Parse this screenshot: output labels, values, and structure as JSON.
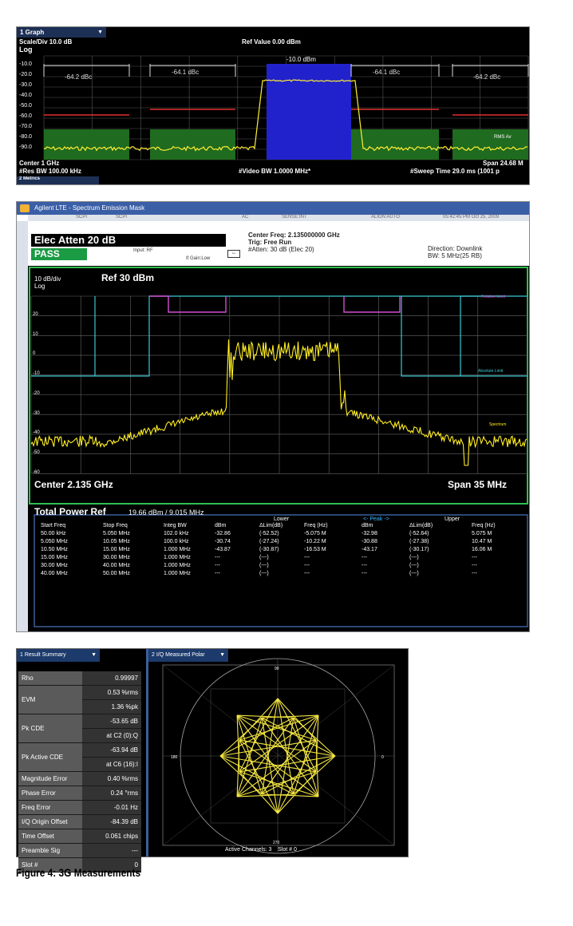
{
  "panel1": {
    "tab_label": "1 Graph",
    "scale": "Scale/Div 10.0 dB",
    "log": "Log",
    "ref_value": "Ref Value 0.00 dBm",
    "y_ticks": [
      "-10.0",
      "-20.0",
      "-30.0",
      "-40.0",
      "-50.0",
      "-60.0",
      "-70.0",
      "-80.0",
      "-90.0"
    ],
    "band_labels": [
      "-64.2 dBc",
      "-64.1 dBc",
      "-10.0 dBm",
      "-64.1 dBc",
      "-64.2 dBc"
    ],
    "center": "Center 1 GHz",
    "res_bw": "#Res BW 100.00 kHz",
    "video_bw": "#Video BW 1.0000 MHz*",
    "span": "Span 24.68 M",
    "sweep": "#Sweep Time 29.0 ms (1001 p",
    "rms": "RMS Av",
    "metrics": "2 Metrics"
  },
  "panel2": {
    "title": "Agilent LTE - Spectrum Emission Mask",
    "menu": [
      "SCPI",
      "SCPI",
      "AC",
      "SENSE:INT",
      "ALIGN AUTO",
      "05:42:45 PM Oct 25, 2009"
    ],
    "elec_atten": "Elec Atten  20 dB",
    "pass": "PASS",
    "input": "Input: RF",
    "gain": "If Gain:Low",
    "center_freq": "Center Freq: 2.135000000 GHz",
    "trig": "Trig: Free Run",
    "atten": "#Atten: 30 dB (Elec 20)",
    "direction": "Direction: Downlink",
    "bw": "BW: 5 MHz(25 RB)",
    "dbdiv": "10 dB/div",
    "ref": "Ref  30 dBm",
    "log": "Log",
    "y_ticks": [
      "20",
      "10",
      "0",
      "-10",
      "-20",
      "-30",
      "-40",
      "-50",
      "-60"
    ],
    "relative_limit": "Relative Limit",
    "absolute_limit": "Absolute Limit",
    "spectrum": "Spectrum",
    "center": "Center  2.135 GHz",
    "span": "Span 35 MHz",
    "total_power": "Total Power Ref",
    "total_power_val": "19.66 dBm /   9.015 MHz",
    "group_lower": "Lower",
    "group_peak": "<- Peak ->",
    "group_upper": "Upper",
    "columns": [
      "Start Freq",
      "Stop Freq",
      "Integ BW",
      "dBm",
      "ΔLim(dB)",
      "Freq (Hz)",
      "dBm",
      "ΔLim(dB)",
      "Freq (Hz)"
    ],
    "rows": [
      [
        "50.00 kHz",
        "5.050 MHz",
        "102.0 kHz",
        "-32.86",
        "(-52.52)",
        "-5.075 M",
        "-32.98",
        "(-52.64)",
        "5.075 M"
      ],
      [
        "5.050 MHz",
        "10.05 MHz",
        "100.0 kHz",
        "-30.74",
        "(-27.24)",
        "-10.22 M",
        "-30.88",
        "(-27.38)",
        "10.47 M"
      ],
      [
        "10.50 MHz",
        "15.00 MHz",
        "1.000 MHz",
        "-43.87",
        "(-30.87)",
        "-16.53 M",
        "-43.17",
        "(-30.17)",
        "16.06 M"
      ],
      [
        "15.00 MHz",
        "30.00 MHz",
        "1.000 MHz",
        "---",
        "(---)",
        "---",
        "---",
        "(---)",
        "---"
      ],
      [
        "30.00 MHz",
        "40.00 MHz",
        "1.000 MHz",
        "---",
        "(---)",
        "---",
        "---",
        "(---)",
        "---"
      ],
      [
        "40.00 MHz",
        "50.00 MHz",
        "1.000 MHz",
        "---",
        "(---)",
        "---",
        "---",
        "(---)",
        "---"
      ]
    ]
  },
  "panel3": {
    "summary_tab": "1 Result Summary",
    "polar_tab": "2 I/Q Measured Polar",
    "summary": [
      {
        "label": "Rho",
        "values": [
          "0.99997"
        ]
      },
      {
        "label": "EVM",
        "values": [
          "0.53 %rms",
          "1.36 %pk"
        ]
      },
      {
        "label": "Pk CDE",
        "values": [
          "-53.65 dB",
          "at C2 (0):Q"
        ]
      },
      {
        "label": "Pk Active CDE",
        "values": [
          "-63.94 dB",
          "at C6 (16):I"
        ]
      },
      {
        "label": "Magnitude Error",
        "values": [
          "0.40 %rms"
        ]
      },
      {
        "label": "Phase Error",
        "values": [
          "0.24 °rms"
        ]
      },
      {
        "label": "Freq Error",
        "values": [
          "-0.01 Hz"
        ]
      },
      {
        "label": "I/Q Origin Offset",
        "values": [
          "-84.39 dB"
        ]
      },
      {
        "label": "Time Offset",
        "values": [
          "0.061 chips"
        ]
      },
      {
        "label": "Preamble Sig",
        "values": [
          "---"
        ]
      },
      {
        "label": "Slot #",
        "values": [
          "0"
        ]
      }
    ],
    "polar_top": "90",
    "polar_left": "180",
    "polar_right": "0",
    "polar_bottom": "270",
    "status": "Active Channels: 3    Slot # 0"
  },
  "caption": "Figure 4: 3G Measurements"
}
